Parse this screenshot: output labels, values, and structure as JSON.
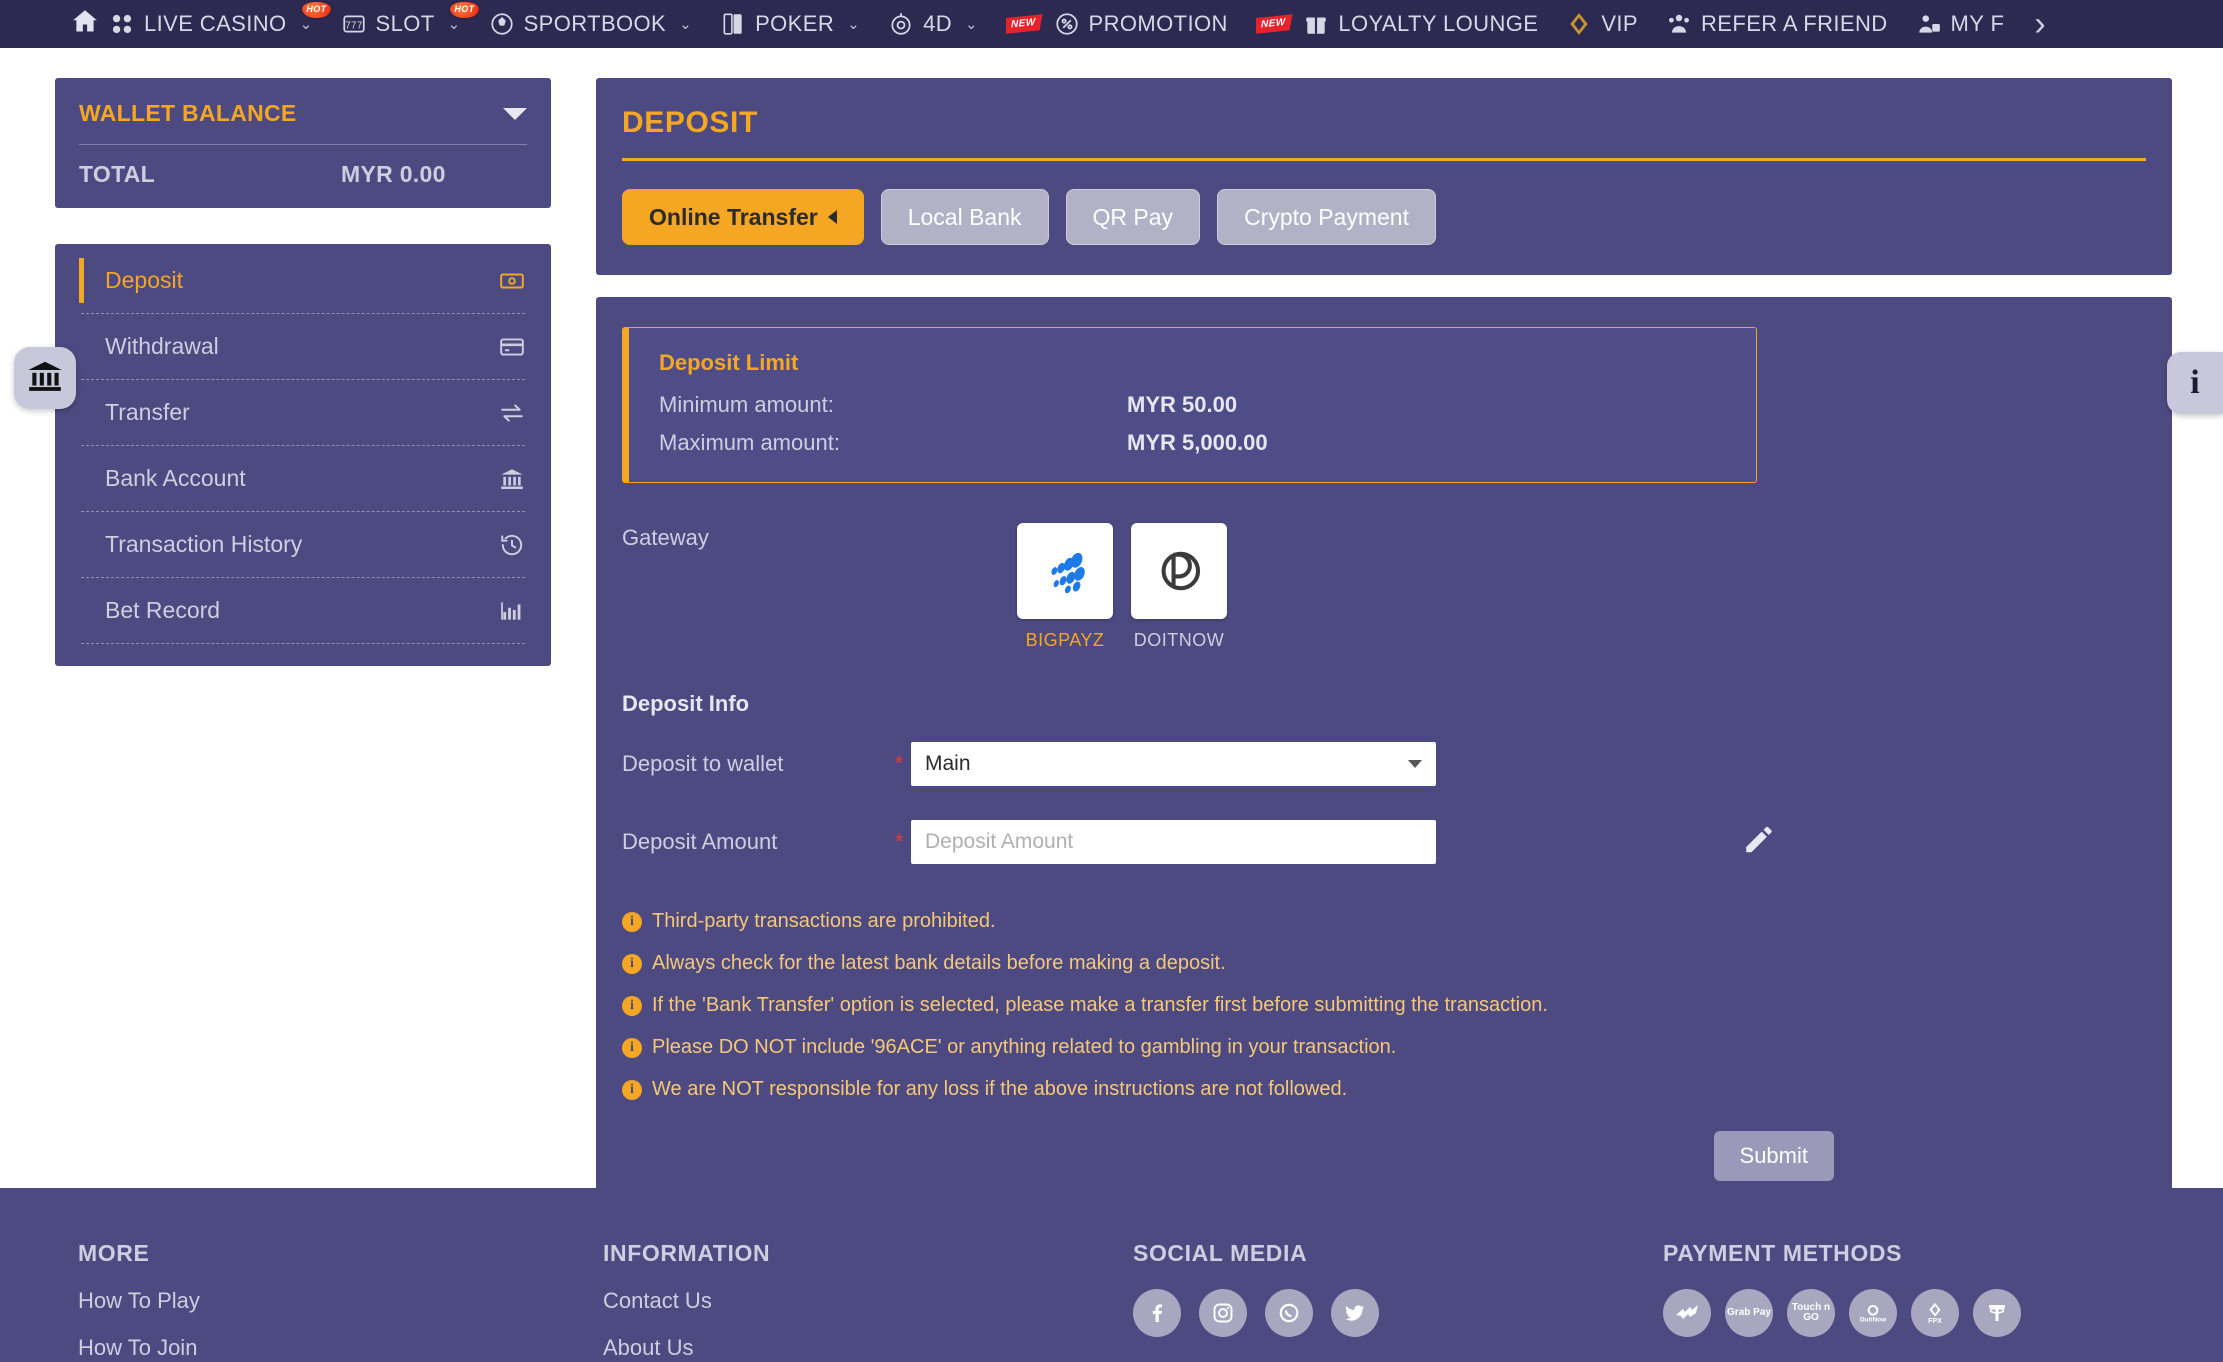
{
  "navbar": {
    "home_icon": "home-icon",
    "overflow_arrow": "chevron-right-icon",
    "items": [
      {
        "label": "LIVE CASINO",
        "icon": "cards-icon",
        "caret": "⌄",
        "badge": "HOT"
      },
      {
        "label": "SLOT",
        "icon": "slot-machine-icon",
        "caret": "⌄",
        "badge": "HOT"
      },
      {
        "label": "SPORTBOOK",
        "icon": "soccer-ball-icon",
        "caret": "⌄",
        "badge": ""
      },
      {
        "label": "POKER",
        "icon": "poker-card-icon",
        "caret": "⌄",
        "badge": ""
      },
      {
        "label": "4D",
        "icon": "lottery-ball-icon",
        "caret": "⌄",
        "badge": ""
      },
      {
        "label": "PROMOTION",
        "icon": "promotion-tag-icon",
        "caret": "",
        "badge": "NEW"
      },
      {
        "label": "LOYALTY LOUNGE",
        "icon": "gift-icon",
        "caret": "",
        "badge": "NEW"
      },
      {
        "label": "VIP",
        "icon": "diamond-icon",
        "caret": "",
        "badge": ""
      },
      {
        "label": "REFER A FRIEND",
        "icon": "people-icon",
        "caret": "",
        "badge": ""
      },
      {
        "label": "MY F",
        "icon": "user-group-icon",
        "caret": "",
        "badge": ""
      }
    ]
  },
  "sidebar": {
    "wallet": {
      "title": "WALLET BALANCE",
      "total_label": "TOTAL",
      "total_value": "MYR 0.00",
      "collapse_icon": "chevron-down-icon"
    },
    "menu": [
      {
        "label": "Deposit",
        "icon": "banknote-icon",
        "active": true
      },
      {
        "label": "Withdrawal",
        "icon": "credit-card-icon",
        "active": false
      },
      {
        "label": "Transfer",
        "icon": "transfer-arrows-icon",
        "active": false
      },
      {
        "label": "Bank Account",
        "icon": "bank-icon",
        "active": false
      },
      {
        "label": "Transaction History",
        "icon": "history-clock-icon",
        "active": false
      },
      {
        "label": "Bet Record",
        "icon": "bar-chart-icon",
        "active": false
      }
    ],
    "float_tab_icon": "bank-icon"
  },
  "main": {
    "page_title": "DEPOSIT",
    "tabs": [
      {
        "label": "Online Transfer",
        "active": true
      },
      {
        "label": "Local Bank",
        "active": false
      },
      {
        "label": "QR Pay",
        "active": false
      },
      {
        "label": "Crypto Payment",
        "active": false
      }
    ],
    "deposit_limit": {
      "title": "Deposit Limit",
      "min_label": "Minimum amount:",
      "min_value": "MYR 50.00",
      "max_label": "Maximum amount:",
      "max_value": "MYR 5,000.00"
    },
    "gateway": {
      "label": "Gateway",
      "options": [
        {
          "name": "BIGPAYZ",
          "logo": "bigpayz-logo",
          "selected": true
        },
        {
          "name": "DOITNOW",
          "logo": "doitnow-logo",
          "selected": false
        }
      ]
    },
    "deposit_info": {
      "section_title": "Deposit Info",
      "wallet_label": "Deposit to wallet",
      "wallet_value": "Main",
      "wallet_required": "*",
      "amount_label": "Deposit Amount",
      "amount_value": "",
      "amount_placeholder": "Deposit Amount",
      "amount_required": "*",
      "edit_icon": "pencil-icon"
    },
    "notes": [
      "Third-party transactions are prohibited.",
      "Always check for the latest bank details before making a deposit.",
      "If the 'Bank Transfer' option is selected, please make a transfer first before submitting the transaction.",
      "Please DO NOT include '96ACE' or anything related to gambling in your transaction.",
      "We are NOT responsible for any loss if the above instructions are not followed."
    ],
    "submit_label": "Submit",
    "float_info_icon": "info-icon"
  },
  "footer": {
    "more": {
      "title": "MORE",
      "links": [
        "How To Play",
        "How To Join"
      ]
    },
    "information": {
      "title": "INFORMATION",
      "links": [
        "Contact Us",
        "About Us"
      ]
    },
    "social": {
      "title": "SOCIAL MEDIA",
      "icons": [
        "facebook-icon",
        "instagram-icon",
        "whatsapp-icon",
        "twitter-icon"
      ]
    },
    "payment": {
      "title": "PAYMENT METHODS",
      "icons": [
        "maybank-icon",
        "grabpay-icon",
        "touchngo-icon",
        "duitnow-icon",
        "fpx-icon",
        "tether-icon"
      ],
      "labels": [
        "",
        "Grab Pay",
        "Touch n GO",
        "DuitNow",
        "FPX",
        ""
      ]
    }
  },
  "colors": {
    "navbar_bg": "#2d2a52",
    "panel_bg": "#4c4a80",
    "accent": "#f5a623",
    "text_muted": "#cfcee0",
    "note_text": "#f5c879",
    "required": "#e53935"
  }
}
